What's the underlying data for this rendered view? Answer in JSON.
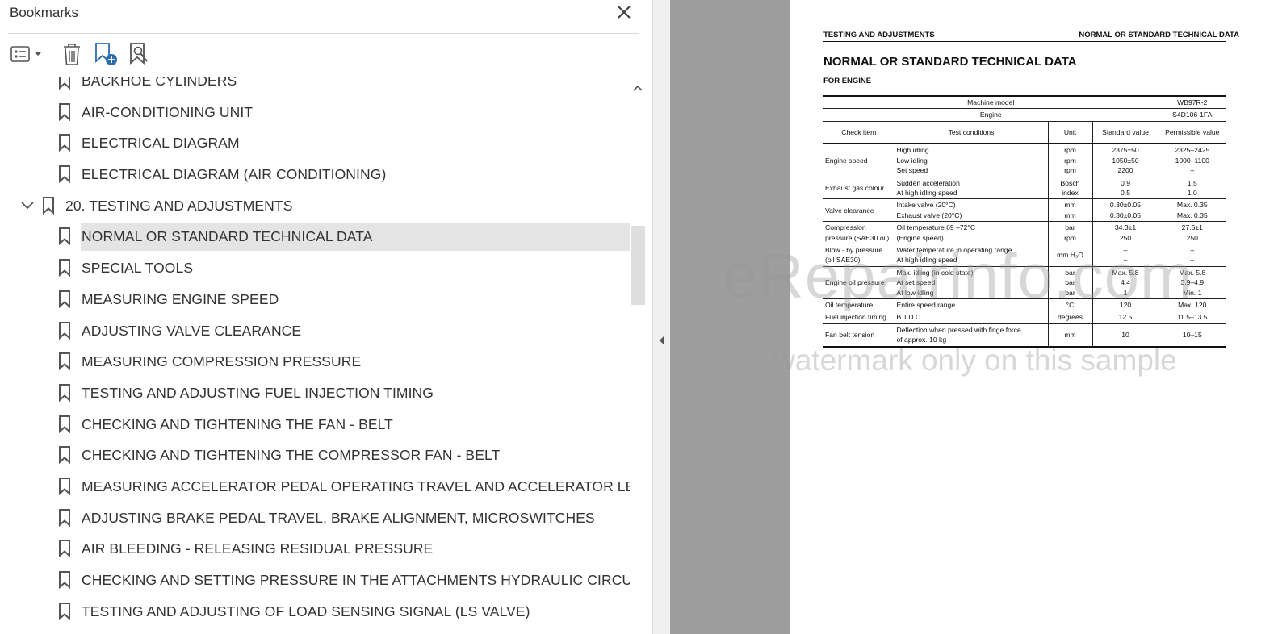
{
  "panel": {
    "title": "Bookmarks",
    "toolbar": [
      "options-menu",
      "delete-bookmark",
      "new-bookmark",
      "find-current-bookmark"
    ]
  },
  "bookmarks": [
    {
      "label": "BACKHOE CYLINDERS",
      "level": 2,
      "selected": false
    },
    {
      "label": "AIR-CONDITIONING UNIT",
      "level": 2,
      "selected": false
    },
    {
      "label": "ELECTRICAL DIAGRAM",
      "level": 2,
      "selected": false
    },
    {
      "label": "ELECTRICAL DIAGRAM (AIR CONDITIONING)",
      "level": 2,
      "selected": false
    },
    {
      "label": "20. TESTING AND ADJUSTMENTS",
      "level": 1,
      "selected": false,
      "expanded": true
    },
    {
      "label": "NORMAL OR STANDARD TECHNICAL DATA",
      "level": 2,
      "selected": true
    },
    {
      "label": "SPECIAL TOOLS",
      "level": 2,
      "selected": false
    },
    {
      "label": "MEASURING ENGINE SPEED",
      "level": 2,
      "selected": false
    },
    {
      "label": "ADJUSTING VALVE CLEARANCE",
      "level": 2,
      "selected": false
    },
    {
      "label": "MEASURING COMPRESSION PRESSURE",
      "level": 2,
      "selected": false
    },
    {
      "label": "TESTING AND ADJUSTING FUEL INJECTION TIMING",
      "level": 2,
      "selected": false
    },
    {
      "label": "CHECKING AND TIGHTENING THE FAN - BELT",
      "level": 2,
      "selected": false
    },
    {
      "label": "CHECKING AND TIGHTENING THE COMPRESSOR FAN - BELT",
      "level": 2,
      "selected": false
    },
    {
      "label": "MEASURING ACCELERATOR PEDAL OPERATING TRAVEL AND ACCELERATOR LEVER",
      "level": 2,
      "selected": false
    },
    {
      "label": "ADJUSTING BRAKE PEDAL TRAVEL, BRAKE ALIGNMENT, MICROSWITCHES",
      "level": 2,
      "selected": false
    },
    {
      "label": "AIR BLEEDING - RELEASING RESIDUAL PRESSURE",
      "level": 2,
      "selected": false
    },
    {
      "label": "CHECKING AND SETTING PRESSURE IN THE ATTACHMENTS HYDRAULIC CIRCUIT",
      "level": 2,
      "selected": false
    },
    {
      "label": "TESTING AND ADJUSTING OF LOAD SENSING SIGNAL (LS VALVE)",
      "level": 2,
      "selected": false
    }
  ],
  "document": {
    "header_left": "TESTING AND ADJUSTMENTS",
    "header_right": "NORMAL OR STANDARD TECHNICAL DATA",
    "title": "NORMAL OR STANDARD TECHNICAL DATA",
    "subtitle": "FOR ENGINE",
    "table": {
      "machine_model_label": "Machine model",
      "machine_model": "WB97R-2",
      "engine_label": "Engine",
      "engine": "S4D106-1FA",
      "col_check_item": "Check item",
      "col_test_conditions": "Test conditions",
      "col_unit": "Unit",
      "col_standard": "Standard value",
      "col_permissible": "Permissible value",
      "rows": [
        {
          "item": "Engine speed",
          "conditions": [
            "High idling",
            "Low idling",
            "Set speed"
          ],
          "units": [
            "rpm",
            "rpm",
            "rpm"
          ],
          "standard": [
            "2375±50",
            "1050±50",
            "2200"
          ],
          "permissible": [
            "2325–2425",
            "1000–1100",
            "–"
          ]
        },
        {
          "item": "Exhaust gas colour",
          "conditions": [
            "Sudden acceleration",
            "At high idling speed"
          ],
          "units": [
            "Bosch",
            "index"
          ],
          "standard": [
            "0.9",
            "0.5"
          ],
          "permissible": [
            "1.5",
            "1.0"
          ]
        },
        {
          "item": "Valve clearance",
          "conditions": [
            "Intake valve (20°C)",
            "Exhaust valve (20°C)"
          ],
          "units": [
            "mm",
            "mm"
          ],
          "standard": [
            "0.30±0.05",
            "0.30±0.05"
          ],
          "permissible": [
            "Max. 0.35",
            "Max. 0.35"
          ]
        },
        {
          "item": "Compression pressure (SAE30 oil)",
          "conditions": [
            "Oil temperature 69 –72°C",
            "(Engine speed)"
          ],
          "units": [
            "bar",
            "rpm"
          ],
          "standard": [
            "34.3±1",
            "250"
          ],
          "permissible": [
            "27.5±1",
            "250"
          ]
        },
        {
          "item": "Blow - by pressure (oil SAE30)",
          "conditions": [
            "Water temperature in operating range",
            "At high idling speed"
          ],
          "units": [
            "mm H₂O"
          ],
          "standard": [
            "–",
            "–"
          ],
          "permissible": [
            "–",
            "–"
          ]
        },
        {
          "item": "Engine oil pressure",
          "conditions": [
            "Max. idling (in cold state)",
            "At set speed",
            "At low idling"
          ],
          "units": [
            "bar",
            "bar",
            "bar"
          ],
          "standard": [
            "Max. 5.8",
            "4.4",
            "1"
          ],
          "permissible": [
            "Max. 5.8",
            "3.9–4.9",
            "Min. 1"
          ]
        },
        {
          "item": "Oil temperature",
          "conditions": [
            "Entire speed range"
          ],
          "units": [
            "°C"
          ],
          "standard": [
            "120"
          ],
          "permissible": [
            "Max. 120"
          ]
        },
        {
          "item": "Fuel injection timing",
          "conditions": [
            "B.T.D.C."
          ],
          "units": [
            "degrees"
          ],
          "standard": [
            "12.5"
          ],
          "permissible": [
            "11.5–13.5"
          ]
        },
        {
          "item": "Fan belt tension",
          "conditions": [
            "Deflection when pressed with finge force",
            "of approx. 10 kg"
          ],
          "units": [
            "mm"
          ],
          "standard": [
            "10"
          ],
          "permissible": [
            "10–15"
          ]
        }
      ]
    },
    "watermark_main": "eRepairinfo.com",
    "watermark_sub": "watermark only on this sample"
  },
  "colors": {
    "selected_row": "#e4e4e4",
    "viewer_bg": "#9e9e9e",
    "icon": "#555555",
    "accent_icon": "#2b6cb0"
  }
}
